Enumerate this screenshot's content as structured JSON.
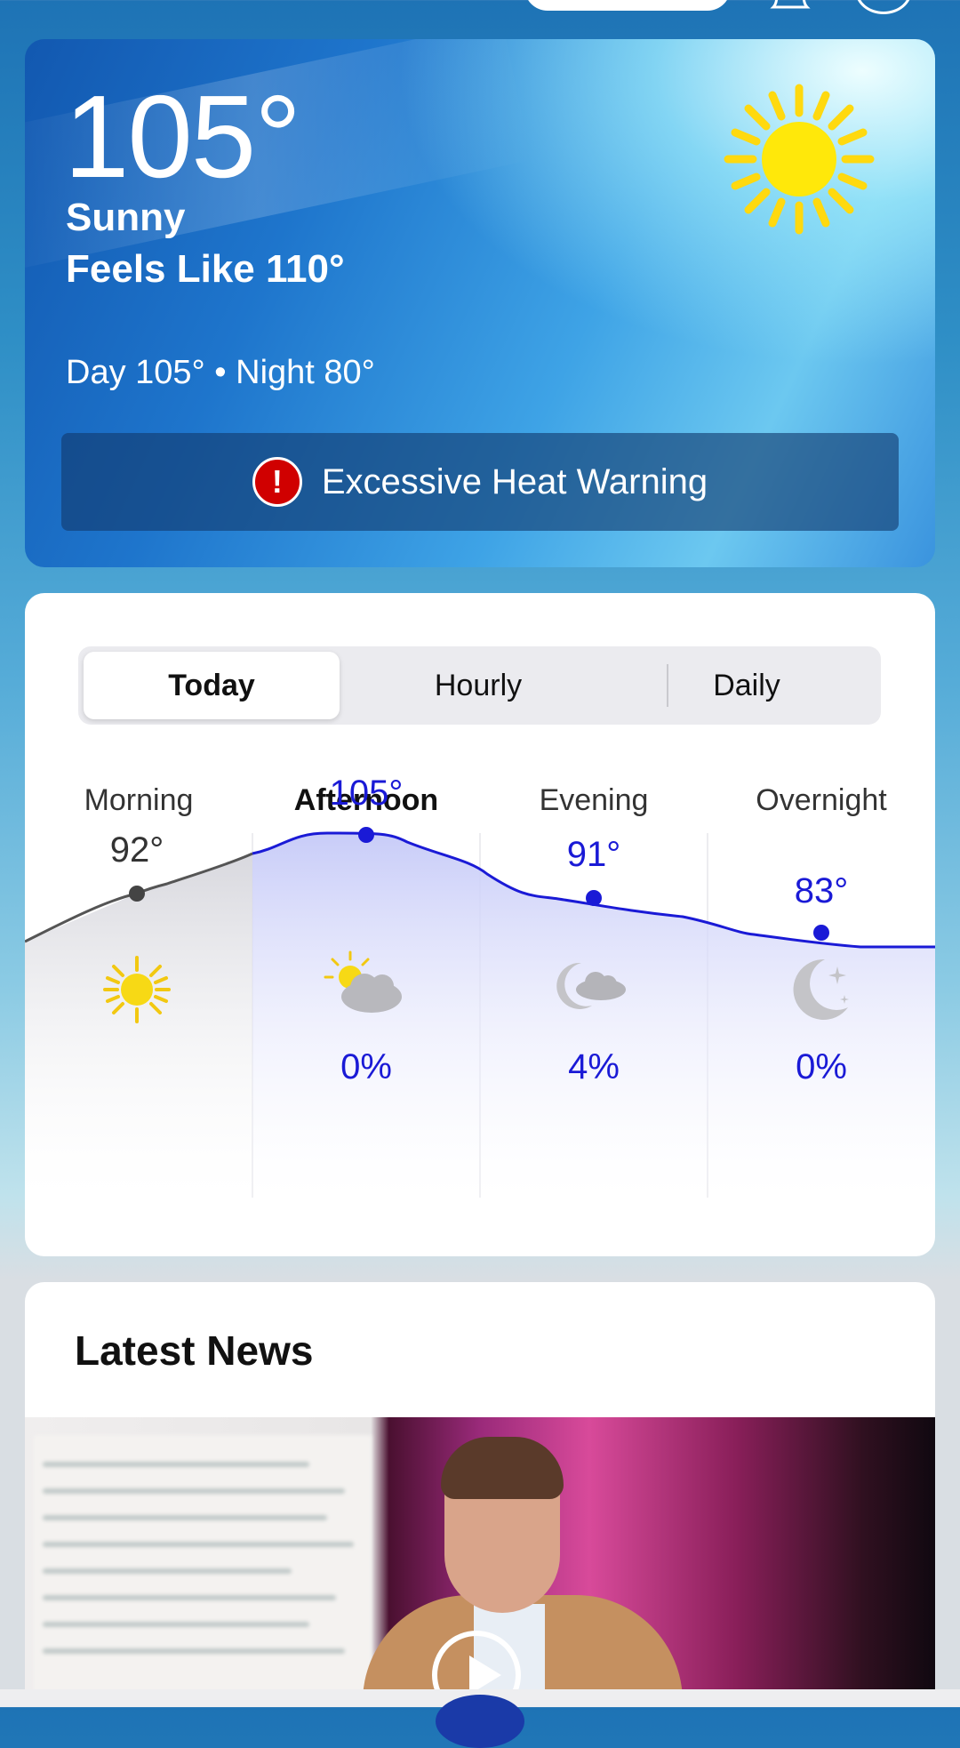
{
  "current": {
    "temperature": "105°",
    "condition": "Sunny",
    "feels_like": "Feels Like 110°",
    "day_night": "Day 105° • Night 80°",
    "condition_icon": "sun-icon",
    "alert": {
      "icon": "alert-icon",
      "icon_glyph": "!",
      "text": "Excessive Heat Warning",
      "color": "#d00000"
    }
  },
  "forecast": {
    "tabs": [
      {
        "label": "Today",
        "active": true
      },
      {
        "label": "Hourly",
        "active": false
      },
      {
        "label": "Daily",
        "active": false
      }
    ],
    "periods": [
      {
        "name": "Morning",
        "temp": "92°",
        "temp_value": 92,
        "icon": "sun-icon",
        "precip": "",
        "highlight": false
      },
      {
        "name": "Afternoon",
        "temp": "105°",
        "temp_value": 105,
        "icon": "partly-cloudy-icon",
        "precip": "0%",
        "highlight": true
      },
      {
        "name": "Evening",
        "temp": "91°",
        "temp_value": 91,
        "icon": "partly-cloudy-night-icon",
        "precip": "4%",
        "highlight": true
      },
      {
        "name": "Overnight",
        "temp": "83°",
        "temp_value": 83,
        "icon": "clear-night-icon",
        "precip": "0%",
        "highlight": true
      }
    ],
    "colors": {
      "past": "#555555",
      "future": "#1a1ad6"
    }
  },
  "news": {
    "title": "Latest News",
    "video_icon": "play-icon"
  }
}
